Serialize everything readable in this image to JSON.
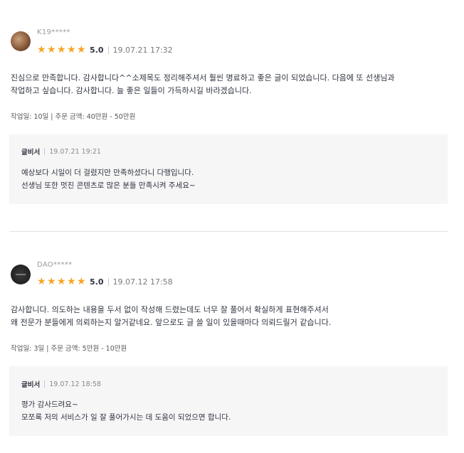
{
  "reviews": [
    {
      "username": "K19*****",
      "rating": "5.0",
      "stars": 5,
      "date": "19.07.21 17:32",
      "text_lines": [
        "진심으로 만족합니다. 감사합니다^^소제목도 정리해주셔서 훨씬 명료하고 좋은 글이 되었습니다. 다음에 또 선생님과",
        "작업하고 싶습니다. 감사합니다. 늘 좋은 일들이 가득하시길 바라겠습니다."
      ],
      "meta": "작업일: 10일 | 주문 금액: 40만원 - 50만원",
      "reply": {
        "name": "글비서",
        "date": "19.07.21 19:21",
        "lines": [
          "예상보다 시일이 더 걸렸지만 만족하셨다니 다행입니다.",
          "선생님 또한 멋진 콘텐츠로 많은 분들 만족시켜 주세요~"
        ]
      }
    },
    {
      "username": "DAO*****",
      "rating": "5.0",
      "stars": 5,
      "date": "19.07.12 17:58",
      "text_lines": [
        "감사합니다. 의도하는 내용을 두서 없이 작성해 드렸는데도 너무 잘 풀어서 확실하게 표현해주셔서",
        "왜 전문가 분들에게 의뢰하는지 알거같네요. 앞으로도 글 쓸 일이 있을때마다 의뢰드릴거 같습니다."
      ],
      "meta": "작업일: 3일 | 주문 금액: 5만원 - 10만원",
      "reply": {
        "name": "글비서",
        "date": "19.07.12 18:58",
        "lines": [
          "평가 감사드려요~",
          "모쪼록 저의 서비스가 일 잘 풀어가시는 데 도움이 되었으면 합니다."
        ]
      }
    }
  ],
  "colors": {
    "star": "#f5a623",
    "reply_bg": "#f6f6f6",
    "divider": "#e2e2e2"
  }
}
